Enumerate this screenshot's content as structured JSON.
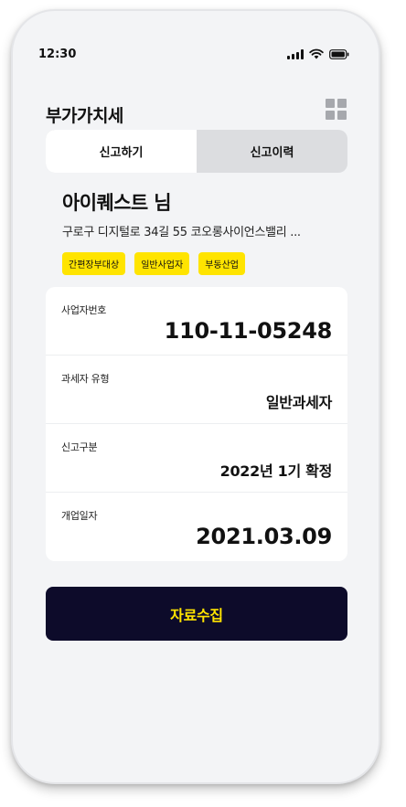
{
  "status_bar": {
    "time": "12:30"
  },
  "header": {
    "title": "부가가치세"
  },
  "tabs": [
    {
      "label": "신고하기",
      "active": true
    },
    {
      "label": "신고이력",
      "active": false
    }
  ],
  "company": {
    "name": "아이퀘스트 님",
    "address": "구로구 디지털로 34길 55 코오롱사이언스밸리 ...",
    "tags": [
      "간편장부대상",
      "일반사업자",
      "부동산업"
    ]
  },
  "info": [
    {
      "label": "사업자번호",
      "value": "110-11-05248"
    },
    {
      "label": "과세자 유형",
      "value": "일반과세자"
    },
    {
      "label": "신고구분",
      "value": "2022년 1기 확정"
    },
    {
      "label": "개업일자",
      "value": "2021.03.09"
    }
  ],
  "action": {
    "collect_label": "자료수집"
  },
  "colors": {
    "accent": "#ffe400",
    "button_bg": "#0d0b2a",
    "screen_bg": "#f3f4f6"
  }
}
